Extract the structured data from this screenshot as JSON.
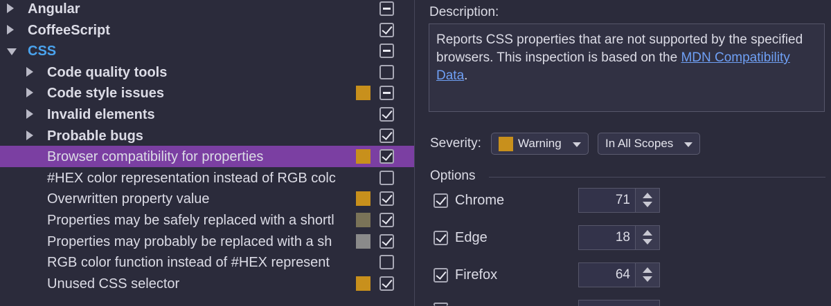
{
  "tree": {
    "items": [
      {
        "label": "Angular",
        "level": 0,
        "expand": "right",
        "bold": true,
        "color": "",
        "swatch": "",
        "check": "indeterminate",
        "selected": false
      },
      {
        "label": "CoffeeScript",
        "level": 0,
        "expand": "right",
        "bold": true,
        "color": "",
        "swatch": "",
        "check": "checked",
        "selected": false
      },
      {
        "label": "CSS",
        "level": 0,
        "expand": "down",
        "bold": true,
        "color": "#4aa3ee",
        "swatch": "",
        "check": "indeterminate",
        "selected": false
      },
      {
        "label": "Code quality tools",
        "level": 1,
        "expand": "right",
        "bold": true,
        "color": "",
        "swatch": "",
        "check": "unchecked",
        "selected": false
      },
      {
        "label": "Code style issues",
        "level": 1,
        "expand": "right",
        "bold": true,
        "color": "",
        "swatch": "#c8901c",
        "check": "indeterminate",
        "selected": false
      },
      {
        "label": "Invalid elements",
        "level": 1,
        "expand": "right",
        "bold": true,
        "color": "",
        "swatch": "",
        "check": "checked",
        "selected": false
      },
      {
        "label": "Probable bugs",
        "level": 1,
        "expand": "right",
        "bold": true,
        "color": "",
        "swatch": "",
        "check": "checked",
        "selected": false
      },
      {
        "label": "Browser compatibility for properties",
        "level": 2,
        "expand": "",
        "bold": false,
        "color": "",
        "swatch": "#c8901c",
        "check": "checked",
        "selected": true
      },
      {
        "label": "#HEX color representation instead of RGB colc",
        "level": 2,
        "expand": "",
        "bold": false,
        "color": "",
        "swatch": "",
        "check": "unchecked",
        "selected": false
      },
      {
        "label": "Overwritten property value",
        "level": 2,
        "expand": "",
        "bold": false,
        "color": "",
        "swatch": "#c8901c",
        "check": "checked",
        "selected": false
      },
      {
        "label": "Properties may be safely replaced with a shortl",
        "level": 2,
        "expand": "",
        "bold": false,
        "color": "",
        "swatch": "#7a7358",
        "check": "checked",
        "selected": false
      },
      {
        "label": "Properties may probably be replaced with a sh",
        "level": 2,
        "expand": "",
        "bold": false,
        "color": "",
        "swatch": "#8a8a8a",
        "check": "checked",
        "selected": false
      },
      {
        "label": "RGB color function instead of #HEX represent",
        "level": 2,
        "expand": "",
        "bold": false,
        "color": "",
        "swatch": "",
        "check": "unchecked",
        "selected": false
      },
      {
        "label": "Unused CSS selector",
        "level": 2,
        "expand": "",
        "bold": false,
        "color": "",
        "swatch": "#c8901c",
        "check": "checked",
        "selected": false
      }
    ]
  },
  "description": {
    "title": "Description:",
    "text_before": "Reports CSS properties that are not supported by the specified browsers. This inspection is based on the ",
    "link": "MDN Compatibility Data",
    "text_after": "."
  },
  "severity": {
    "label": "Severity:",
    "value": "Warning",
    "swatch_color": "#c8901c",
    "scope": "In All Scopes"
  },
  "options": {
    "title": "Options",
    "browsers": [
      {
        "name": "Chrome",
        "version": "71",
        "checked": true
      },
      {
        "name": "Edge",
        "version": "18",
        "checked": true
      },
      {
        "name": "Firefox",
        "version": "64",
        "checked": true
      }
    ]
  },
  "colors": {
    "selection": "#7b3fa2",
    "link": "#6fa0f5",
    "group_accent": "#4aa3ee",
    "warning": "#c8901c"
  }
}
